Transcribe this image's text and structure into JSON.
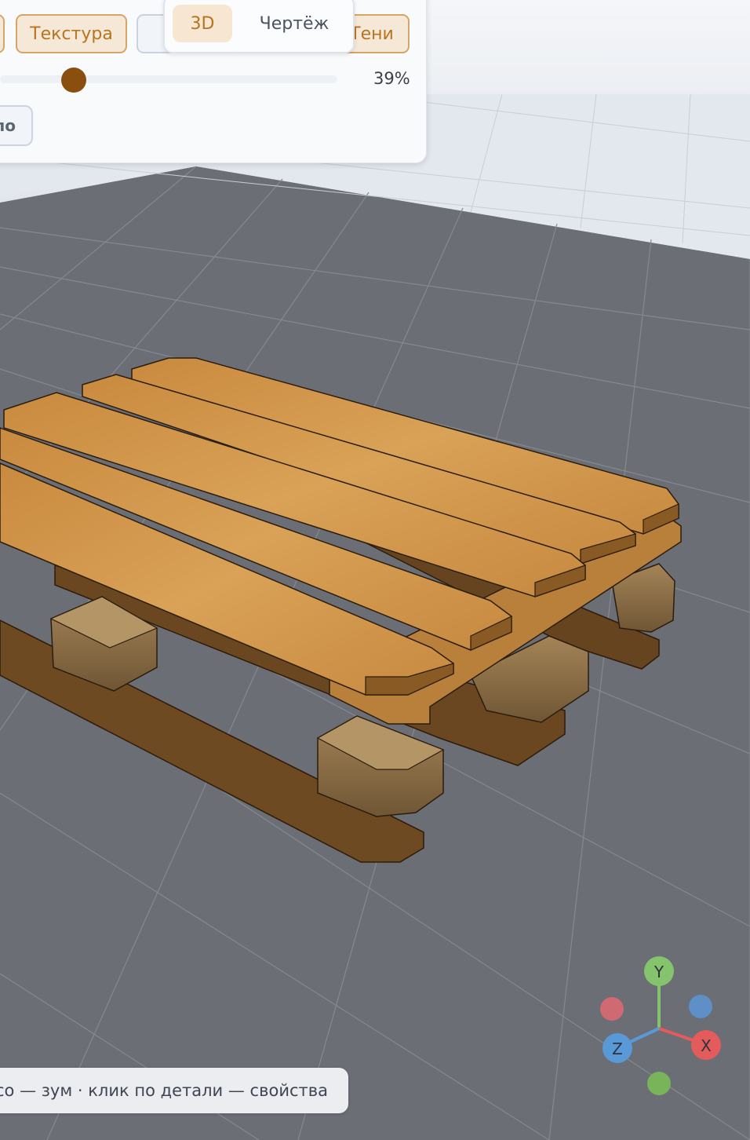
{
  "toolbar": {
    "left_partial_label": "",
    "texture_label": "Текстура",
    "grid_label": "",
    "hidden_label": "",
    "shadows_label": "Тени",
    "opacity_value": "39%",
    "opacity_level": 0.39,
    "reset_label": "ло"
  },
  "view_mode": {
    "options": [
      "3D",
      "Чертёж"
    ],
    "selected": "3D"
  },
  "status_hint": "со — зум · клик по детали — свойства",
  "axis_gizmo": {
    "x_label": "X",
    "y_label": "Y",
    "z_label": "Z",
    "colors": {
      "x": "#e35b5b",
      "y": "#85c46c",
      "z": "#5a99d8"
    }
  },
  "colors": {
    "accent": "#b8741f",
    "wood_light": "#d69a4e",
    "wood_dark": "#7a4f22",
    "floor": "#6b6e74",
    "sky": "#eaedf2"
  }
}
